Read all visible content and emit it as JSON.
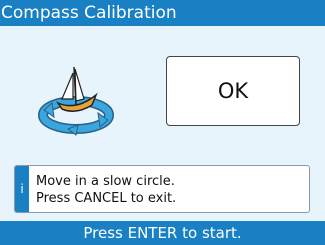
{
  "window": {
    "title": "Compass Calibration"
  },
  "ok_button": {
    "label": "OK"
  },
  "info": {
    "icon_glyph": "i",
    "line1": "Move in a slow circle.",
    "line2": "Press CANCEL to exit."
  },
  "footer": {
    "text": "Press ENTER to start."
  },
  "icons": {
    "illustration": "sailboat-circle-arrows-icon",
    "info": "info-icon"
  },
  "colors": {
    "accent": "#1a80c4",
    "panel_bg": "#e7f4fb",
    "ring": "#3aa6de"
  }
}
